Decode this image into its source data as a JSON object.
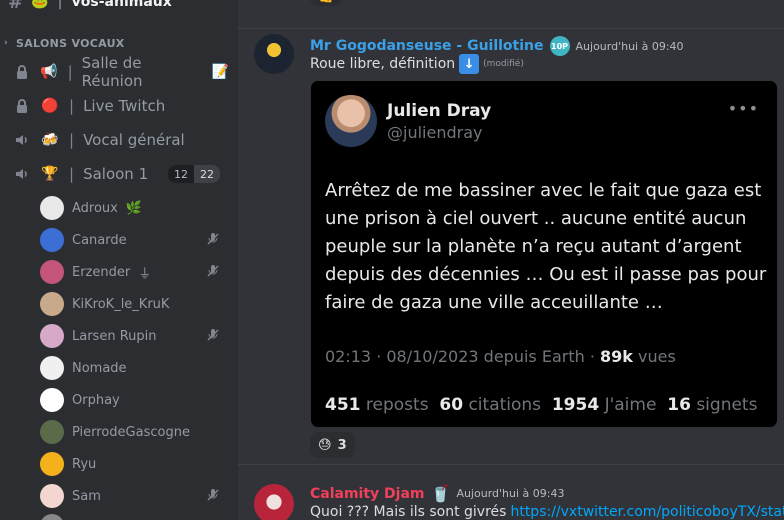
{
  "sidebar": {
    "top_channel": {
      "icon": "hash-icon",
      "emoji": "🐸",
      "label": "vos-animaux"
    },
    "category": {
      "label": "SALONS VOCAUX"
    },
    "voice_channels": [
      {
        "icon": "lock-icon",
        "emoji": "📢",
        "label": "Salle de Réunion",
        "trail_emoji": "📝"
      },
      {
        "icon": "lock-icon",
        "emoji": "🔴",
        "label": "Live Twitch"
      },
      {
        "icon": "speaker-icon",
        "emoji": "🍻",
        "label": "Vocal général"
      },
      {
        "icon": "speaker-icon",
        "emoji": "🏆",
        "label": "Saloon 1",
        "count_a": "12",
        "count_b": "22"
      }
    ],
    "users": [
      {
        "name": "Adroux",
        "suffix": "🌿",
        "muted": false,
        "avatar_color": "#e8e8e8"
      },
      {
        "name": "Canarde",
        "suffix": "",
        "muted": true,
        "avatar_color": "#3b6fd6"
      },
      {
        "name": "Erzender",
        "suffix": "⏚",
        "muted": true,
        "avatar_color": "#c4547a"
      },
      {
        "name": "KiKroK_le_KruK",
        "suffix": "",
        "muted": false,
        "avatar_color": "#c9a98b"
      },
      {
        "name": "Larsen Rupin",
        "suffix": "",
        "muted": true,
        "avatar_color": "#d7a9c8"
      },
      {
        "name": "Nomade",
        "suffix": "",
        "muted": false,
        "avatar_color": "#f0f0f0"
      },
      {
        "name": "Orphay",
        "suffix": "",
        "muted": false,
        "avatar_color": "#ffffff"
      },
      {
        "name": "PierrodeGascogne",
        "suffix": "",
        "muted": false,
        "avatar_color": "#5a6b4a"
      },
      {
        "name": "Ryu",
        "suffix": "",
        "muted": false,
        "avatar_color": "#f3b21c"
      },
      {
        "name": "Sam",
        "suffix": "",
        "muted": true,
        "avatar_color": "#f4d6d0"
      }
    ]
  },
  "messages": [
    {
      "author": "Mr Gogodanseuse - Guillotine",
      "author_color": "#3aa0e8",
      "badge": "10P",
      "timestamp": "Aujourd'hui à 09:40",
      "text": "Roue libre, définition",
      "edited": "(modifié)",
      "tweet": {
        "name": "Julien Dray",
        "handle": "@juliendray",
        "body": "Arrêtez de me bassiner avec le fait que gaza est une prison à ciel ouvert ..  aucune entité aucun peuple sur la planète n’a reçu autant d’argent depuis des décennies … Ou est il passe pas pour faire de gaza une ville acceuillante …",
        "meta": "02:13 · 08/10/2023 depuis Earth ·",
        "views_value": "89k",
        "views_label": "vues",
        "reposts_value": "451",
        "reposts_label": "reposts",
        "quotes_value": "60",
        "quotes_label": "citations",
        "likes_value": "1954",
        "likes_label": "J'aime",
        "bookmarks_value": "16",
        "bookmarks_label": "signets"
      },
      "reaction": {
        "emoji": "😓",
        "count": "3"
      }
    },
    {
      "author": "Calamity Djam",
      "author_color": "#f23f5a",
      "author_emoji": "🥤",
      "timestamp": "Aujourd'hui à 09:43",
      "text": "Quoi ??? Mais ils sont givrés",
      "link": "https://vxtwitter.com/politicoboyTX/status"
    }
  ]
}
